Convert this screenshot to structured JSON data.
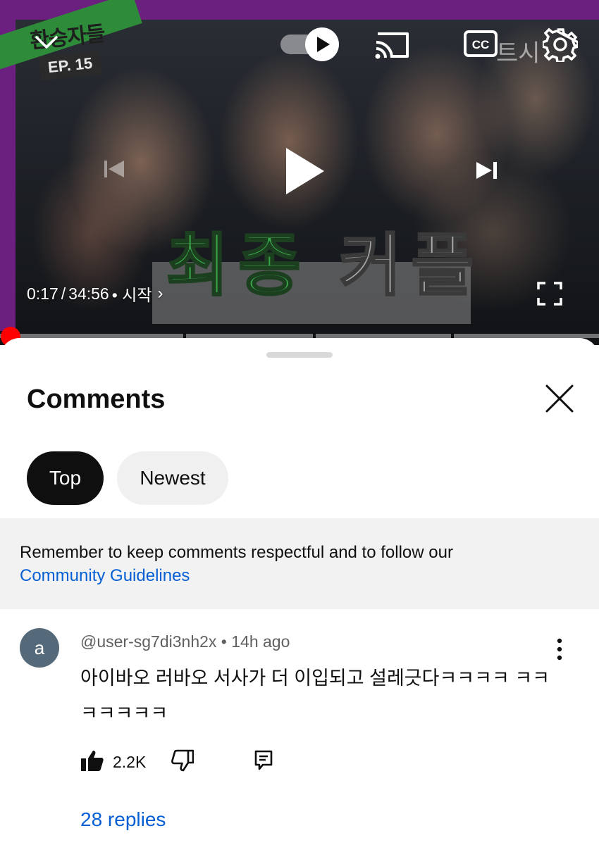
{
  "player": {
    "show_logo": "환승자들",
    "episode": "EP. 15",
    "overlay_title_green": "최종",
    "overlay_title_gray": "커플",
    "watermark": "트시",
    "current_time": "0:17",
    "separator": "/",
    "duration": "34:56",
    "chapter": "• 시작",
    "chapter_chevron": "›",
    "progress_fraction": 0.008,
    "accent_color": "#ff0000",
    "icons": {
      "collapse": "chevron-down-icon",
      "autoplay": "autoplay-toggle-icon",
      "cast": "cast-icon",
      "captions": "cc-icon",
      "settings": "gear-icon",
      "previous": "skip-previous-icon",
      "play": "play-icon",
      "next": "skip-next-icon",
      "fullscreen": "fullscreen-icon"
    }
  },
  "comments_sheet": {
    "title": "Comments",
    "close_icon": "close-icon",
    "filters": [
      {
        "label": "Top",
        "selected": true
      },
      {
        "label": "Newest",
        "selected": false
      }
    ],
    "notice": {
      "text": "Remember to keep comments respectful and to follow our",
      "link": "Community Guidelines"
    },
    "comments": [
      {
        "avatar_letter": "a",
        "avatar_color": "#546a7b",
        "author": "@user-sg7di3nh2x",
        "dot": "•",
        "time": "14h ago",
        "text": "아이바오 러바오 서사가 더 이입되고 설레긋다ㅋㅋㅋㅋ ㅋㅋㅋㅋㅋㅋㅋ",
        "likes": "2.2K",
        "replies_label": "28 replies"
      }
    ],
    "link_color": "#065fd4"
  }
}
